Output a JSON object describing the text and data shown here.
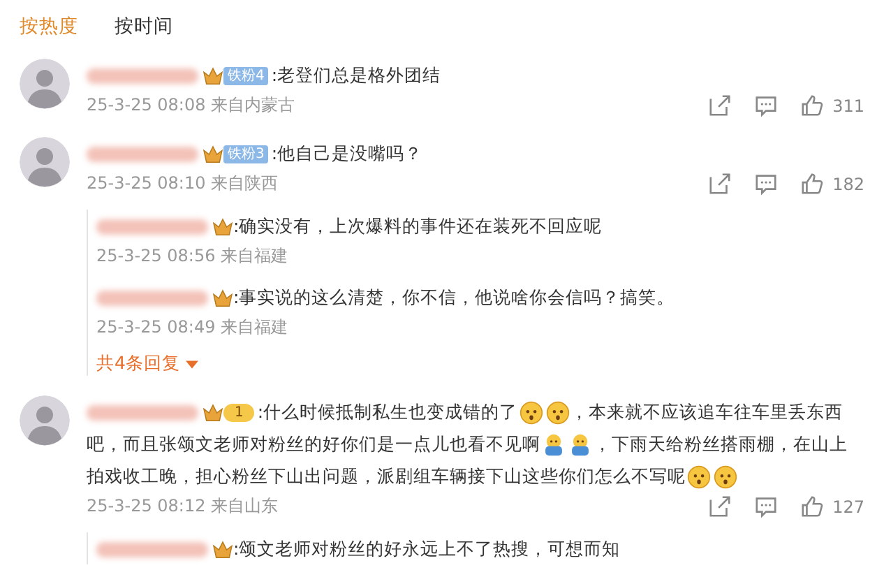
{
  "sort_tabs": [
    {
      "label": "按热度",
      "selected": true
    },
    {
      "label": "按时间",
      "selected": false
    }
  ],
  "comments": [
    {
      "badge": {
        "kind": "fan",
        "label": "铁粉4"
      },
      "lines": [
        [
          {
            "kind": "text",
            "text": ":老登们总是格外团结"
          }
        ]
      ],
      "time": "25-3-25 08:08 来自内蒙古",
      "likes": "311"
    },
    {
      "badge": {
        "kind": "fan",
        "label": "铁粉3"
      },
      "lines": [
        [
          {
            "kind": "text",
            "text": ":他自己是没嘴吗？"
          }
        ]
      ],
      "time": "25-3-25 08:10 来自陕西",
      "likes": "182",
      "replies": [
        {
          "badge": {
            "kind": "crown"
          },
          "text": ":确实没有，上次爆料的事件还在装死不回应呢",
          "time": "25-3-25 08:56 来自福建"
        },
        {
          "badge": {
            "kind": "crown"
          },
          "text": ":事实说的这么清楚，你不信，他说啥你会信吗？搞笑。",
          "time": "25-3-25 08:49 来自福建"
        }
      ],
      "more_replies": "共4条回复"
    },
    {
      "badge": {
        "kind": "level",
        "label": "1"
      },
      "lines": [
        [
          {
            "kind": "text",
            "text": ":什么时候抵制私生也变成错的了"
          },
          {
            "kind": "emoji-think"
          },
          {
            "kind": "emoji-think"
          },
          {
            "kind": "text",
            "text": "，本来就不应该追车往车里丢东西"
          }
        ],
        [
          {
            "kind": "text",
            "text": "吧，而且张颂文老师对粉丝的好你们是一点儿也看不见啊"
          },
          {
            "kind": "emoji-hug"
          },
          {
            "kind": "emoji-hug"
          },
          {
            "kind": "text",
            "text": "，下雨天给粉丝搭雨棚，在山上"
          }
        ],
        [
          {
            "kind": "text",
            "text": "拍戏收工晚，担心粉丝下山出问题，派剧组车辆接下山这些你们怎么不写呢"
          },
          {
            "kind": "emoji-think"
          },
          {
            "kind": "emoji-think"
          }
        ]
      ],
      "time": "25-3-25 08:12 来自山东",
      "likes": "127",
      "replies": [
        {
          "badge": {
            "kind": "crown"
          },
          "text": ":颂文老师对粉丝的好永远上不了热搜，可想而知"
        }
      ]
    }
  ]
}
